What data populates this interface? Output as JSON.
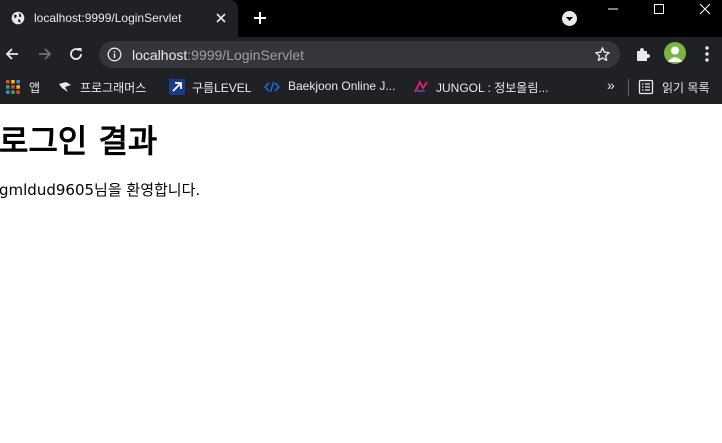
{
  "tab": {
    "title": "localhost:9999/LoginServlet"
  },
  "omnibox": {
    "host": "localhost",
    "rest": ":9999/LoginServlet"
  },
  "bookmarks": [
    {
      "label": "앱",
      "icon": "apps-grid-icon"
    },
    {
      "label": "프로그래머스",
      "icon": "programmers-icon"
    },
    {
      "label": "구름LEVEL",
      "icon": "goorm-level-icon"
    },
    {
      "label": "Baekjoon Online J...",
      "icon": "baekjoon-icon"
    },
    {
      "label": "JUNGOL : 정보올림...",
      "icon": "jungol-icon"
    }
  ],
  "bookmarks_overflow": "»",
  "reading_list": {
    "label": "읽기 목록",
    "icon": "reading-list-icon"
  },
  "page": {
    "title": "로그인 결과",
    "welcome": "gmldud9605님을 환영합니다."
  },
  "colors": {
    "tabstrip": "#000000",
    "toolbar": "#202124",
    "omnibox": "#35363a",
    "avatar": "#7cb342",
    "text_light": "#e8eaed",
    "text_dim": "#9aa0a6"
  }
}
